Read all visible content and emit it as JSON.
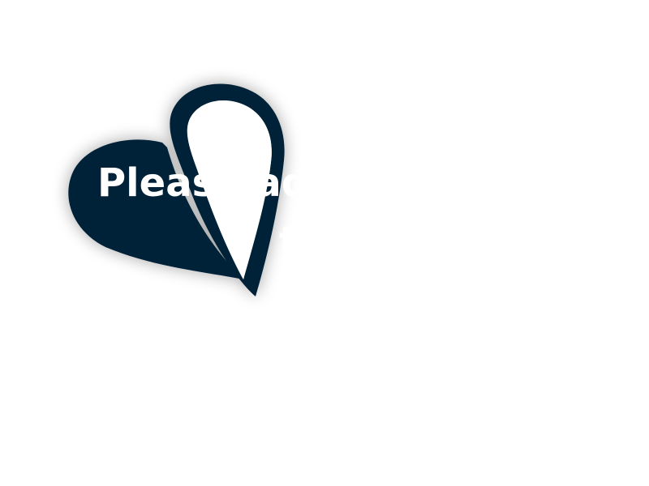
{
  "overlay": {
    "line1": "Please add",
    "line2": "t"
  },
  "colors": {
    "background": "#ffffff",
    "heart_fill": "#062338",
    "text": "#ffffff"
  },
  "icons": {
    "heart": "broken-half-heart-icon"
  }
}
